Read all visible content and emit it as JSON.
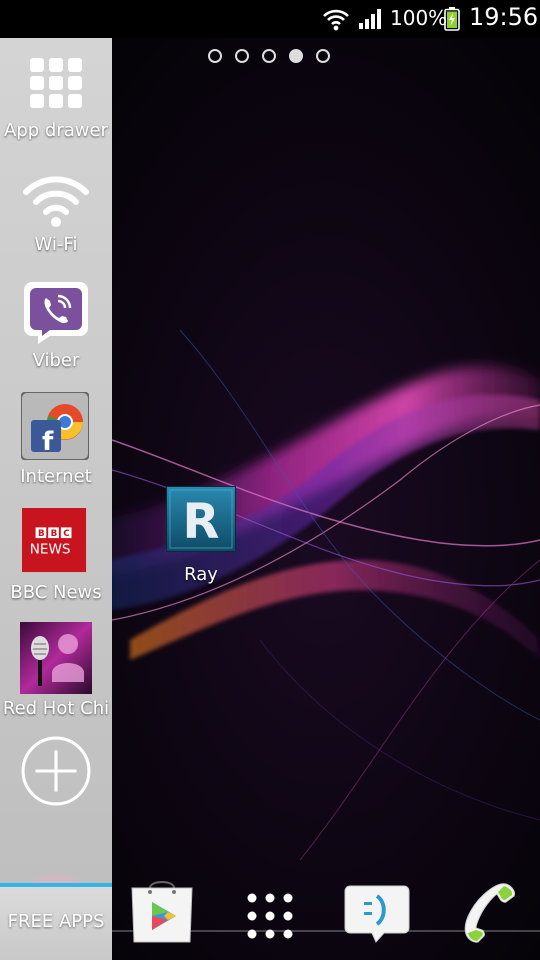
{
  "status_bar": {
    "battery_percent": "100%",
    "time": "19:56",
    "icons": [
      "wifi-icon",
      "signal-icon",
      "battery-charging-icon"
    ]
  },
  "page_indicator": {
    "count": 5,
    "active_index": 3
  },
  "sidebar": {
    "items": [
      {
        "label": "App drawer",
        "icon": "app-drawer-grid-icon"
      },
      {
        "label": "Wi-Fi",
        "icon": "wifi-icon"
      },
      {
        "label": "Viber",
        "icon": "viber-icon"
      },
      {
        "label": "Internet",
        "icon": "internet-browser-icon"
      },
      {
        "label": "BBC News",
        "icon": "bbc-news-icon"
      },
      {
        "label": "Red Hot Chi",
        "icon": "red-hot-chi-icon"
      },
      {
        "label": "",
        "icon": "add-circle-icon"
      }
    ],
    "free_apps_label": "FREE APPS",
    "accent_color": "#33b5e5"
  },
  "desktop": {
    "shortcut": {
      "label": "Ray",
      "icon": "ray-app-icon",
      "glyph": "R"
    }
  },
  "dock": {
    "items": [
      {
        "icon": "play-store-icon"
      },
      {
        "icon": "apps-grid-icon"
      },
      {
        "icon": "messaging-icon"
      },
      {
        "icon": "phone-icon"
      }
    ]
  }
}
